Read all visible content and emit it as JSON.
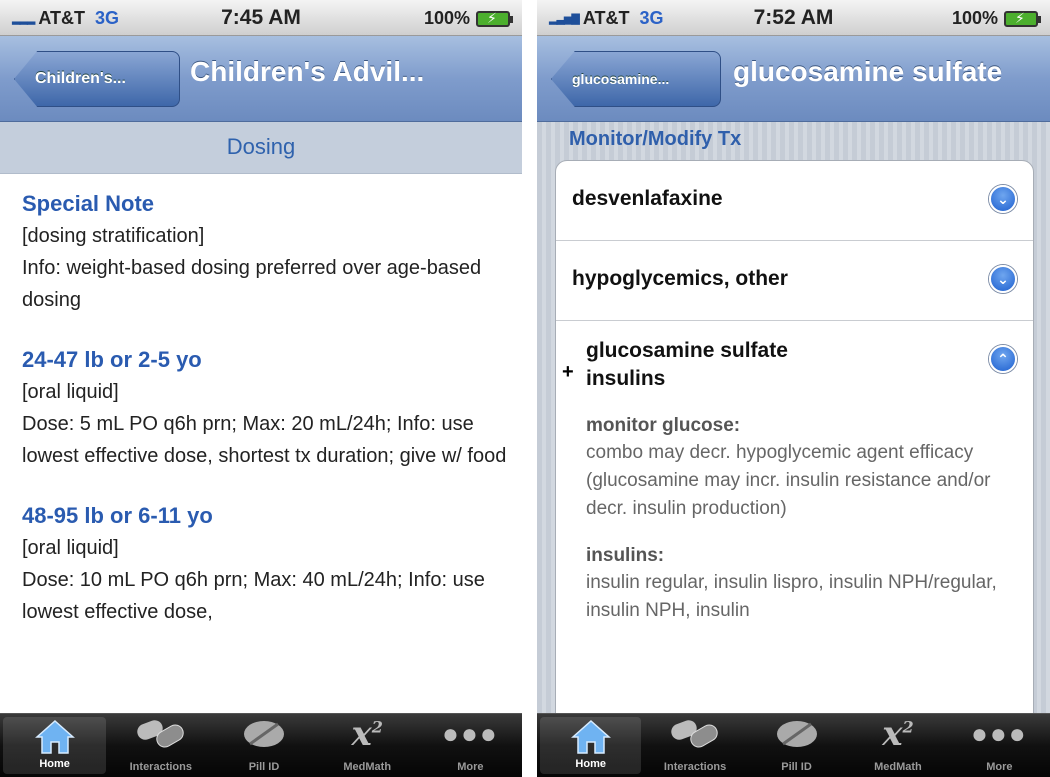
{
  "left": {
    "status": {
      "carrier": "AT&T",
      "network": "3G",
      "time": "7:45 AM",
      "battery": "100%"
    },
    "nav": {
      "back_label": "Children's...",
      "title": "Children's Advil..."
    },
    "section_header": "Dosing",
    "blocks": [
      {
        "heading": "Special Note",
        "lines": [
          "[dosing stratification]",
          "Info: weight-based dosing preferred over age-based dosing"
        ]
      },
      {
        "heading": "24-47 lb or 2-5 yo",
        "lines": [
          "[oral liquid]",
          "Dose: 5 mL PO q6h prn; Max: 20 mL/24h; Info: use lowest effective dose, shortest tx duration; give w/ food"
        ]
      },
      {
        "heading": "48-95 lb or 6-11 yo",
        "lines": [
          "[oral liquid]",
          "Dose: 10 mL PO q6h prn; Max: 40 mL/24h; Info: use lowest effective dose,"
        ]
      }
    ]
  },
  "right": {
    "status": {
      "carrier": "AT&T",
      "network": "3G",
      "time": "7:52 AM",
      "battery": "100%"
    },
    "nav": {
      "back_label": "glucosamine...",
      "title": "glucosamine sulfate"
    },
    "group_title": "Monitor/Modify Tx",
    "rows": [
      {
        "label": "desvenlafaxine"
      },
      {
        "label": "hypoglycemics, other"
      }
    ],
    "expanded": {
      "plus": "+",
      "title": "glucosamine sulfate insulins",
      "details": [
        {
          "heading": "monitor glucose:",
          "text": "combo may decr. hypoglycemic agent efficacy (glucosamine may incr. insulin resistance and/or decr. insulin production)"
        },
        {
          "heading": "insulins:",
          "text": "insulin regular, insulin lispro, insulin NPH/regular, insulin NPH, insulin"
        }
      ]
    }
  },
  "tabs": [
    {
      "label": "Home",
      "icon": "home-icon"
    },
    {
      "label": "Interactions",
      "icon": "pills-icon"
    },
    {
      "label": "Pill ID",
      "icon": "pill-icon"
    },
    {
      "label": "MedMath",
      "icon": "math-x-squared-icon",
      "glyph": "x",
      "sup": "2"
    },
    {
      "label": "More",
      "icon": "more-dots-icon"
    }
  ],
  "colors": {
    "accent": "#2a5bb0",
    "nav": "#7f9ccc",
    "tabbar": "#111111"
  }
}
